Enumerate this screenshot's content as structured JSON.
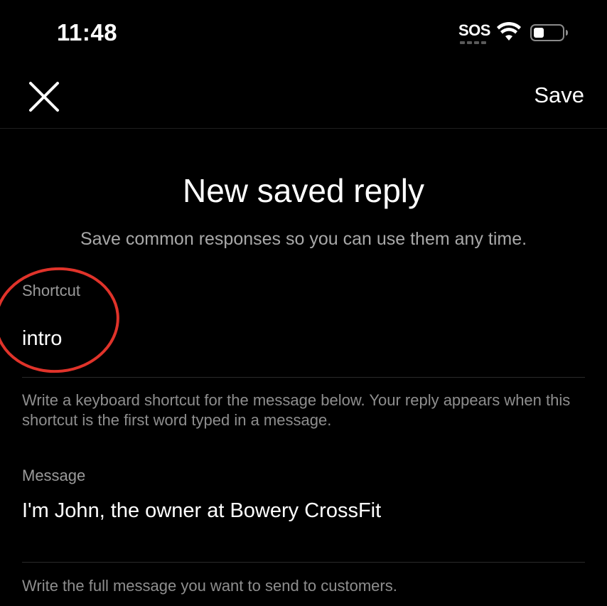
{
  "status_bar": {
    "time": "11:48",
    "sos_label": "SOS",
    "icons": [
      "sos-signal-icon",
      "wifi-icon",
      "battery-icon"
    ]
  },
  "nav": {
    "close_icon": "close-icon",
    "save_label": "Save"
  },
  "header": {
    "title": "New saved reply",
    "subtitle": "Save common responses so you can use them any time."
  },
  "shortcut_field": {
    "label": "Shortcut",
    "value": "intro",
    "help": "Write a keyboard shortcut for the message below. Your reply appears when this shortcut is the first word typed in a message."
  },
  "message_field": {
    "label": "Message",
    "value": "I'm John, the owner at Bowery CrossFit",
    "help": "Write the full message you want to send to customers."
  },
  "colors": {
    "background": "#000000",
    "text_primary": "#ffffff",
    "text_secondary": "#a8a8a8",
    "annotation": "#e0332a"
  }
}
